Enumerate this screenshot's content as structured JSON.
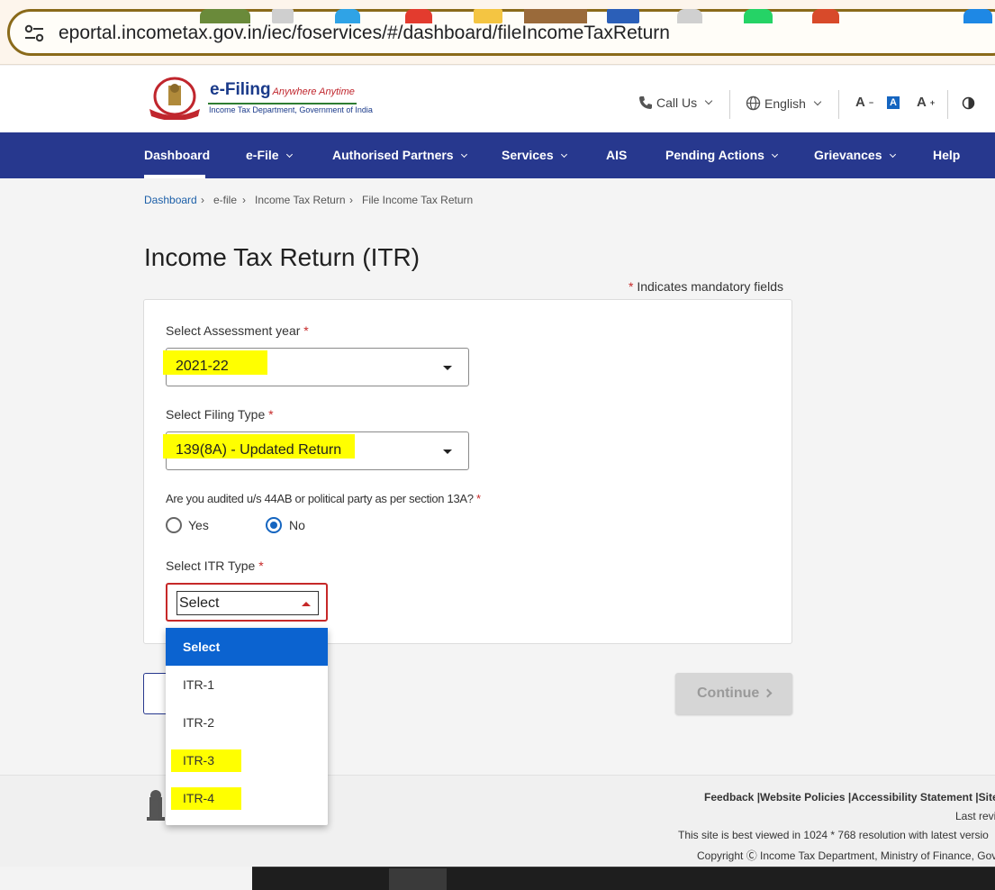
{
  "browser": {
    "url": "eportal.incometax.gov.in/iec/foservices/#/dashboard/fileIncomeTaxReturn"
  },
  "header": {
    "logo_title": "e-Filing",
    "logo_tagline": "Anywhere Anytime",
    "logo_subtitle": "Income Tax Department, Government of India",
    "call_us": "Call Us",
    "language": "English",
    "font_decrease": "A",
    "font_reset": "A",
    "font_increase": "A"
  },
  "nav": {
    "items": [
      {
        "label": "Dashboard",
        "active": true
      },
      {
        "label": "e-File",
        "dropdown": true
      },
      {
        "label": "Authorised Partners",
        "dropdown": true
      },
      {
        "label": "Services",
        "dropdown": true
      },
      {
        "label": "AIS"
      },
      {
        "label": "Pending Actions",
        "dropdown": true
      },
      {
        "label": "Grievances",
        "dropdown": true
      },
      {
        "label": "Help"
      }
    ]
  },
  "breadcrumb": [
    "Dashboard",
    "e-file",
    "Income Tax Return",
    "File Income Tax Return"
  ],
  "page": {
    "title": "Income Tax Return (ITR)",
    "mandatory_note": "Indicates mandatory fields"
  },
  "form": {
    "assessment_year": {
      "label": "Select Assessment year",
      "value": "2021-22"
    },
    "filing_type": {
      "label": "Select Filing Type",
      "value": "139(8A) - Updated Return"
    },
    "audit_question": {
      "label": "Are you audited u/s 44AB or political party as per section 13A?",
      "options": [
        "Yes",
        "No"
      ],
      "selected": "No"
    },
    "itr_type": {
      "label": "Select ITR Type",
      "value": "Select",
      "options": [
        "Select",
        "ITR-1",
        "ITR-2",
        "ITR-3",
        "ITR-4"
      ],
      "highlighted": [
        "ITR-3",
        "ITR-4"
      ]
    },
    "continue_label": "Continue"
  },
  "footer": {
    "links": "Feedback |Website Policies |Accessibility Statement |Site Ma",
    "last_reviewed": "Last revi",
    "resolution": "This site is best viewed in 1024 * 768 resolution with latest versio",
    "copyright": "Copyright Ⓒ Income Tax Department, Ministry of Finance, Gove"
  },
  "colors": {
    "nav_bg": "#27388e",
    "highlight": "#ffff00",
    "selected_option": "#0b63d0",
    "error_border": "#c62828"
  }
}
